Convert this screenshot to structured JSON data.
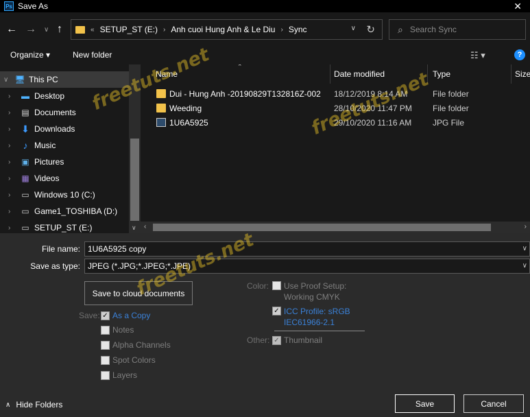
{
  "window": {
    "title": "Save As",
    "app_badge": "Ps"
  },
  "nav": {
    "address": {
      "overflow_marker": "«",
      "segments": [
        "SETUP_ST (E:)",
        "Anh cuoi Hung Anh & Le Diu",
        "Sync"
      ]
    },
    "search_placeholder": "Search Sync"
  },
  "toolbar": {
    "organize_label": "Organize ▾",
    "new_folder_label": "New folder"
  },
  "tree": [
    {
      "label": "This PC",
      "icon": "pc-icon",
      "selected": true,
      "expanded": true
    },
    {
      "label": "Desktop",
      "icon": "desktop-icon"
    },
    {
      "label": "Documents",
      "icon": "documents-icon"
    },
    {
      "label": "Downloads",
      "icon": "downloads-icon"
    },
    {
      "label": "Music",
      "icon": "music-icon"
    },
    {
      "label": "Pictures",
      "icon": "pictures-icon"
    },
    {
      "label": "Videos",
      "icon": "videos-icon"
    },
    {
      "label": "Windows 10 (C:)",
      "icon": "drive-c-icon"
    },
    {
      "label": "Game1_TOSHIBA (D:)",
      "icon": "drive-d-icon"
    },
    {
      "label": "SETUP_ST (E:)",
      "icon": "drive-e-icon"
    }
  ],
  "columns": {
    "name": "Name",
    "date": "Date modified",
    "type": "Type",
    "size": "Size"
  },
  "files": [
    {
      "name": "Dui - Hung  Anh -20190829T132816Z-002",
      "date": "18/12/2019 8:14 AM",
      "type": "File folder",
      "icon": "folder-icon"
    },
    {
      "name": "Weeding",
      "date": "28/10/2020 11:47 PM",
      "type": "File folder",
      "icon": "folder-icon"
    },
    {
      "name": "1U6A5925",
      "date": "29/10/2020 11:16 AM",
      "type": "JPG File",
      "icon": "jpg-file-icon"
    }
  ],
  "form": {
    "file_name_label": "File name:",
    "file_name_value": "1U6A5925 copy",
    "save_type_label": "Save as type:",
    "save_type_value": "JPEG (*.JPG;*.JPEG;*.JPE)",
    "cloud_button": "Save to cloud documents",
    "save_group_label": "Save:",
    "save_options": [
      {
        "label": "As a Copy",
        "checked": true,
        "link": true
      },
      {
        "label": "Notes",
        "checked": false
      },
      {
        "label": "Alpha Channels",
        "checked": false
      },
      {
        "label": "Spot Colors",
        "checked": false
      },
      {
        "label": "Layers",
        "checked": false
      }
    ],
    "color_group_label": "Color:",
    "proof_setup_line1": "Use Proof Setup:",
    "proof_setup_line2": "Working CMYK",
    "icc_line1": "ICC Profile:  sRGB",
    "icc_line2": "IEC61966-2.1",
    "other_group_label": "Other:",
    "thumbnail_label": "Thumbnail"
  },
  "footer": {
    "hide_folders": "Hide Folders",
    "save": "Save",
    "cancel": "Cancel"
  },
  "watermark": "freetuts.net"
}
